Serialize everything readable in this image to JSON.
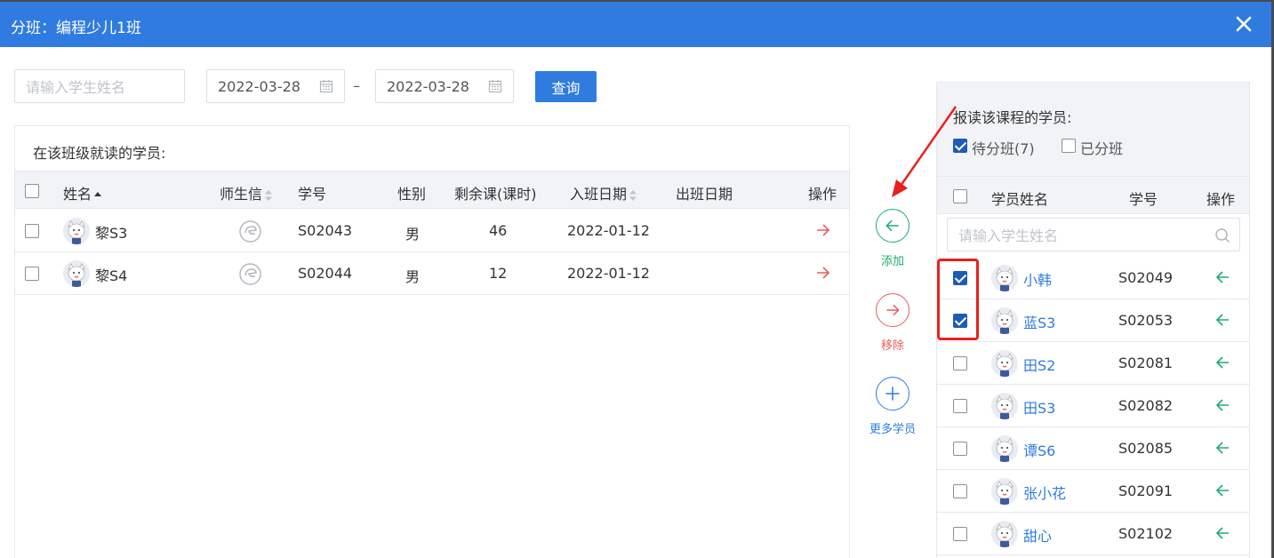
{
  "dialog": {
    "title": "分班：编程少儿1班"
  },
  "filters": {
    "name_placeholder": "请输入学生姓名",
    "date_start": "2022-03-28",
    "date_separator": "–",
    "date_end": "2022-03-28",
    "query_label": "查询"
  },
  "left": {
    "title": "在该班级就读的学员:",
    "columns": {
      "name": "姓名",
      "wechat": "师生信",
      "id": "学号",
      "gender": "性别",
      "remaining": "剩余课(课时)",
      "join_date": "入班日期",
      "leave_date": "出班日期",
      "action": "操作"
    },
    "rows": [
      {
        "name": "黎S3",
        "id": "S02043",
        "gender": "男",
        "remaining": "46",
        "join_date": "2022-01-12",
        "leave_date": ""
      },
      {
        "name": "黎S4",
        "id": "S02044",
        "gender": "男",
        "remaining": "12",
        "join_date": "2022-01-12",
        "leave_date": ""
      }
    ]
  },
  "middle": {
    "add_label": "添加",
    "remove_label": "移除",
    "more_label": "更多学员"
  },
  "right": {
    "title": "报读该课程的学员:",
    "filter_pending": "待分班(7)",
    "filter_pending_checked": true,
    "filter_assigned": "已分班",
    "filter_assigned_checked": false,
    "columns": {
      "name": "学员姓名",
      "id": "学号",
      "action": "操作"
    },
    "search_placeholder": "请输入学生姓名",
    "rows": [
      {
        "name": "小韩",
        "id": "S02049",
        "checked": true
      },
      {
        "name": "蓝S3",
        "id": "S02053",
        "checked": true
      },
      {
        "name": "田S2",
        "id": "S02081",
        "checked": false
      },
      {
        "name": "田S3",
        "id": "S02082",
        "checked": false
      },
      {
        "name": "谭S6",
        "id": "S02085",
        "checked": false
      },
      {
        "name": "张小花",
        "id": "S02091",
        "checked": false
      },
      {
        "name": "甜心",
        "id": "S02102",
        "checked": false
      }
    ]
  },
  "colors": {
    "primary": "#2f7bdf",
    "add": "#1aad6f",
    "remove": "#e85d5d",
    "highlight": "#e8201f"
  }
}
